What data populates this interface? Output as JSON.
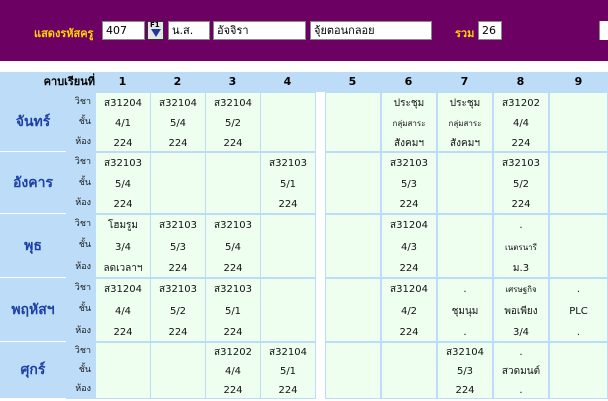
{
  "header": {
    "teacher_code_label": "แสดงรหัสครู",
    "teacher_code": "407",
    "f1_label": "F1",
    "title_prefix": "น.ส.",
    "first_name": "อัจจิรา",
    "last_name": "จุ้ยตอนกลอย",
    "total_label": "รวม",
    "total": "26"
  },
  "colors": {
    "banner": "#6d0063",
    "label": "#ffd400",
    "header_bg": "#bcdcf7",
    "cell_bg": "#eefff0",
    "day_text": "#1c3fa6"
  },
  "table": {
    "period_header": "คาบเรียนที่",
    "periods": [
      "1",
      "2",
      "3",
      "4",
      "5",
      "6",
      "7",
      "8",
      "9"
    ],
    "row_labels": [
      "วิชา",
      "ชั้น",
      "ห้อง"
    ],
    "days": [
      {
        "name": "จันทร์",
        "cells": [
          [
            "ส31204",
            "4/1",
            "224"
          ],
          [
            "ส32104",
            "5/4",
            "224"
          ],
          [
            "ส32104",
            "5/2",
            "224"
          ],
          [
            "",
            "",
            ""
          ],
          [
            "",
            "",
            ""
          ],
          [
            "ประชุม",
            "กลุ่มสาระ",
            "สังคมฯ"
          ],
          [
            "ประชุม",
            "กลุ่มสาระ",
            "สังคมฯ"
          ],
          [
            "ส31202",
            "4/4",
            "224"
          ],
          [
            "",
            "",
            ""
          ]
        ]
      },
      {
        "name": "อังคาร",
        "cells": [
          [
            "ส32103",
            "5/4",
            "224"
          ],
          [
            "",
            "",
            ""
          ],
          [
            "",
            "",
            ""
          ],
          [
            "ส32103",
            "5/1",
            "224"
          ],
          [
            "",
            "",
            ""
          ],
          [
            "ส32103",
            "5/3",
            "224"
          ],
          [
            "",
            "",
            ""
          ],
          [
            "ส32103",
            "5/2",
            "224"
          ],
          [
            "",
            "",
            ""
          ]
        ]
      },
      {
        "name": "พุธ",
        "cells": [
          [
            "โฮมรูม",
            "3/4",
            "ลดเวลาฯ"
          ],
          [
            "ส32103",
            "5/3",
            "224"
          ],
          [
            "ส32103",
            "5/4",
            "224"
          ],
          [
            "",
            "",
            ""
          ],
          [
            "",
            "",
            ""
          ],
          [
            "ส31204",
            "4/3",
            "224"
          ],
          [
            "",
            "",
            ""
          ],
          [
            ".",
            "เนตรนารี",
            "ม.3"
          ],
          [
            "",
            "",
            ""
          ]
        ]
      },
      {
        "name": "พฤหัสฯ",
        "cells": [
          [
            "ส31204",
            "4/4",
            "224"
          ],
          [
            "ส32103",
            "5/2",
            "224"
          ],
          [
            "ส32103",
            "5/1",
            "224"
          ],
          [
            "",
            "",
            ""
          ],
          [
            "",
            "",
            ""
          ],
          [
            "ส31204",
            "4/2",
            "224"
          ],
          [
            ".",
            "ชุมนุม",
            "."
          ],
          [
            "เศรษฐกิจ",
            "พอเพียง",
            "3/4"
          ],
          [
            ".",
            "PLC",
            "."
          ]
        ]
      },
      {
        "name": "ศุกร์",
        "cells": [
          [
            "",
            "",
            ""
          ],
          [
            "",
            "",
            ""
          ],
          [
            "ส31202",
            "4/4",
            "224"
          ],
          [
            "ส32104",
            "5/1",
            "224"
          ],
          [
            "",
            "",
            ""
          ],
          [
            "",
            "",
            ""
          ],
          [
            "ส32104",
            "5/3",
            "224"
          ],
          [
            ".",
            "สวดมนต์",
            "."
          ],
          [
            "",
            "",
            ""
          ]
        ]
      }
    ]
  }
}
